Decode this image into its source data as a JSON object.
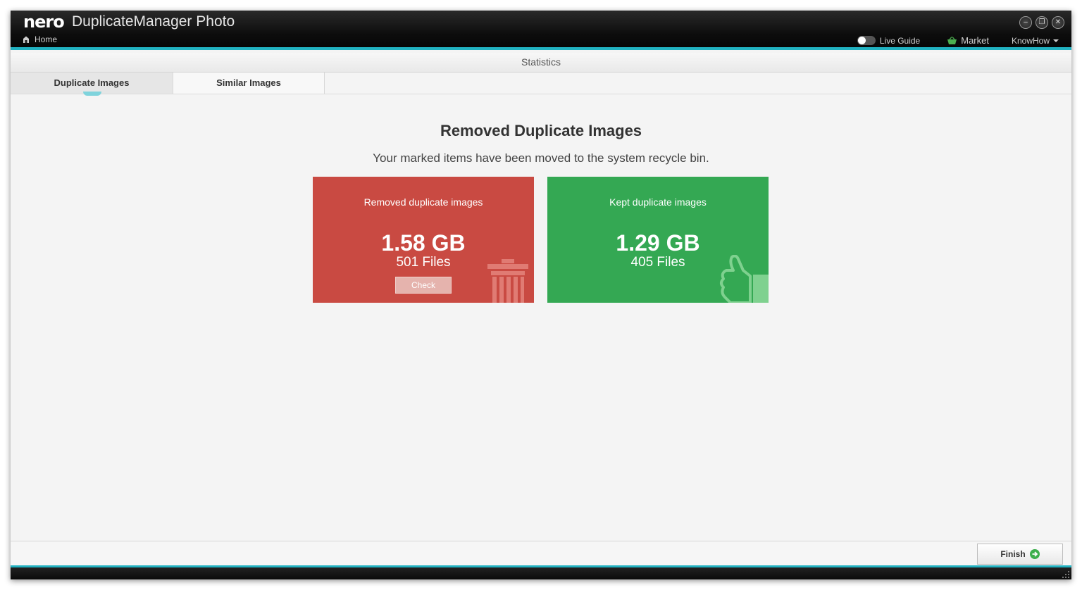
{
  "window": {
    "logo": "nero",
    "title": "DuplicateManager Photo",
    "home_label": "Home",
    "live_guide_label": "Live Guide",
    "market_label": "Market",
    "knowhow_label": "KnowHow",
    "controls": [
      "minimize-icon",
      "restore-icon",
      "close-icon"
    ]
  },
  "section": {
    "title": "Statistics"
  },
  "tabs": [
    {
      "label": "Duplicate Images",
      "active": true
    },
    {
      "label": "Similar Images",
      "active": false
    }
  ],
  "main": {
    "title": "Removed Duplicate Images",
    "subtitle": "Your marked items have been moved to the system recycle bin."
  },
  "cards": {
    "removed": {
      "label": "Removed duplicate images",
      "size": "1.58 GB",
      "files": "501 Files",
      "button_label": "Check",
      "color": "#c94a42",
      "icon": "trash-icon"
    },
    "kept": {
      "label": "Kept duplicate images",
      "size": "1.29 GB",
      "files": "405 Files",
      "color": "#34a853",
      "icon": "thumbs-up-icon"
    }
  },
  "footer": {
    "finish_label": "Finish"
  },
  "colors": {
    "accent": "#21b2c1"
  }
}
